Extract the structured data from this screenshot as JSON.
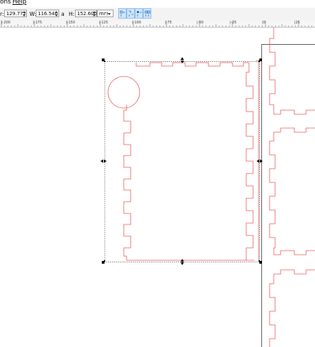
{
  "menu": {
    "items": [
      {
        "label": "ons"
      },
      {
        "label": "Help"
      }
    ]
  },
  "toolbar": {
    "x": {
      "label": "r:",
      "value": "129.772"
    },
    "w": {
      "label": "W:",
      "value": "116.540"
    },
    "lock_label": "a",
    "h": {
      "label": "H:",
      "value": "152.600"
    },
    "unit": "mm",
    "transform_buttons": [
      {
        "icon": "scale-stroke-icon"
      },
      {
        "icon": "scale-corners-icon"
      },
      {
        "icon": "move-gradients-icon"
      },
      {
        "icon": "move-patterns-icon"
      }
    ]
  },
  "ruler": {
    "labels": [
      "|-200",
      "|-175",
      "|-150",
      "|-125",
      "|-100",
      "|-75",
      "|-50",
      "|-25",
      "|0",
      "|25"
    ]
  },
  "colors": {
    "cut_path": "#e8504f",
    "selection": "#000000",
    "page_border": "#555555",
    "toolbar_button": "#cfe6fb"
  }
}
